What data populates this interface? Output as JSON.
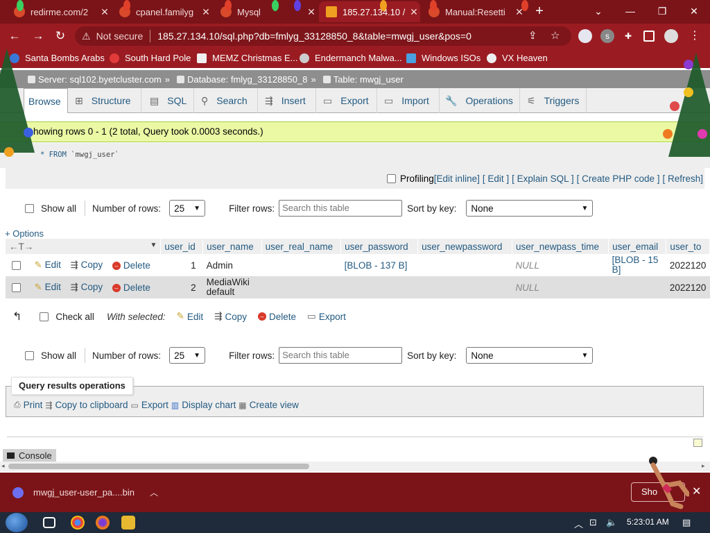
{
  "browser": {
    "tabs": [
      {
        "label": "redirme.com/2",
        "active": false
      },
      {
        "label": "cpanel.familyg",
        "active": false
      },
      {
        "label": "Mysql",
        "active": false
      },
      {
        "label": "185.27.134.10 /",
        "active": true
      },
      {
        "label": "Manual:Resetti",
        "active": false
      }
    ],
    "address": {
      "security_label": "Not secure",
      "url": "185.27.134.10/sql.php?db=fmlyg_33128850_8&table=mwgj_user&pos=0"
    },
    "bookmarks": [
      "Santa Bombs Arabs",
      "South Hard Pole",
      "MEMZ Christmas E...",
      "Endermanch Malwa...",
      "Windows ISOs",
      "VX Heaven"
    ],
    "extension_letter": "s"
  },
  "breadcrumb": {
    "server": "Server: sql102.byetcluster.com",
    "database": "Database: fmlyg_33128850_8",
    "table": "Table: mwgj_user"
  },
  "tabs": [
    "Browse",
    "Structure",
    "SQL",
    "Search",
    "Insert",
    "Export",
    "Import",
    "Operations",
    "Triggers"
  ],
  "status": {
    "message": "howing rows 0 - 1 (2 total, Query took 0.0003 seconds.)",
    "sql_keyword": "* FROM",
    "sql_table": "`mwgj_user`"
  },
  "profiling": {
    "label": "Profiling",
    "links": [
      "[Edit inline]",
      "[ Edit ]",
      "[ Explain SQL ]",
      "[ Create PHP code ]",
      "[ Refresh]"
    ]
  },
  "nav": {
    "show_all": "Show all",
    "num_rows_label": "Number of rows:",
    "num_rows_value": "25",
    "filter_label": "Filter rows:",
    "filter_placeholder": "Search this table",
    "sort_label": "Sort by key:",
    "sort_value": "None"
  },
  "options_label": "+ Options",
  "table": {
    "columns": [
      "user_id",
      "user_name",
      "user_real_name",
      "user_password",
      "user_newpassword",
      "user_newpass_time",
      "user_email",
      "user_to"
    ],
    "actions": [
      "Edit",
      "Copy",
      "Delete"
    ],
    "rows": [
      {
        "user_id": "1",
        "user_name": "Admin",
        "user_real_name": "",
        "user_password": "[BLOB - 137 B]",
        "user_newpassword": "",
        "user_newpass_time": "NULL",
        "user_email_l1": "[BLOB - 15",
        "user_email_l2": "B]",
        "user_to": "2022120"
      },
      {
        "user_id": "2",
        "user_name_l1": "MediaWiki",
        "user_name_l2": "default",
        "user_real_name": "",
        "user_password": "",
        "user_newpassword": "",
        "user_newpass_time": "NULL",
        "user_email": "",
        "user_to": "2022120"
      }
    ]
  },
  "with_selected": {
    "check_all": "Check all",
    "label": "With selected:",
    "actions": [
      "Edit",
      "Copy",
      "Delete",
      "Export"
    ]
  },
  "query_ops": {
    "title": "Query results operations",
    "links": [
      "Print",
      "Copy to clipboard",
      "Export",
      "Display chart",
      "Create view"
    ]
  },
  "console_label": "Console",
  "download": {
    "filename": "mwgj_user-user_pa....bin",
    "show_all": "Sho"
  },
  "taskbar": {
    "clock": "5:23:01 AM"
  },
  "colors": {
    "chrome_dark": "#7a1418",
    "chrome": "#9a1c22",
    "link": "#235a81",
    "success_bg": "#ebf8a4"
  }
}
